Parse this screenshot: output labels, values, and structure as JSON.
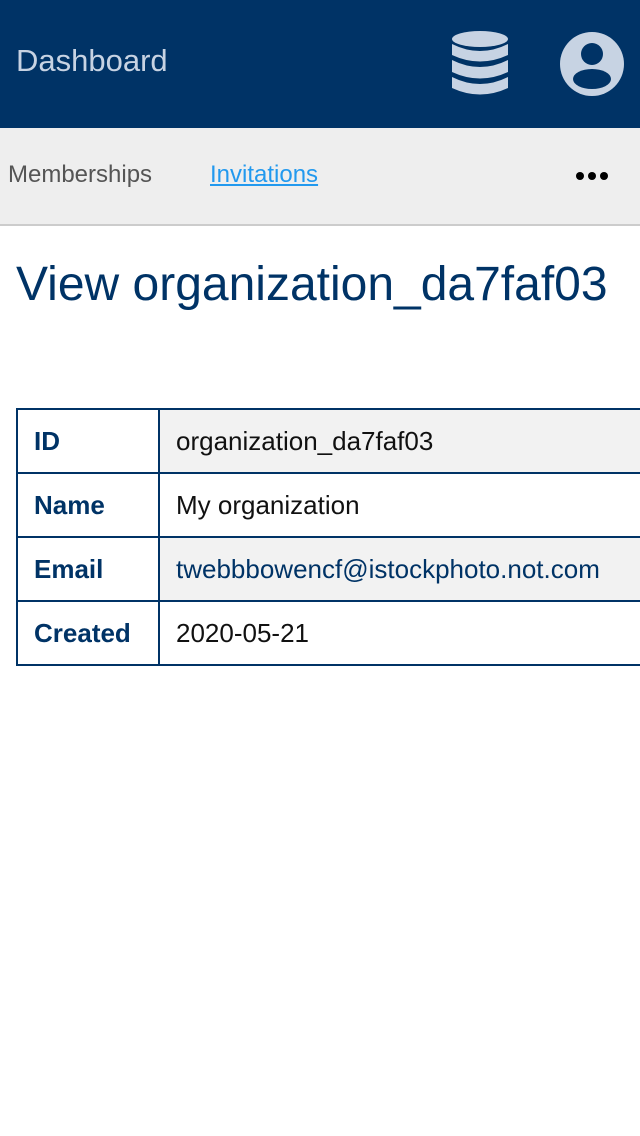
{
  "header": {
    "brand": "Dashboard",
    "icons": {
      "database": "database-icon",
      "account": "user-circle-icon"
    },
    "colors": {
      "background": "#003366",
      "icon": "#c7d3e3"
    }
  },
  "subnav": {
    "items": [
      {
        "label": "Memberships",
        "active": false
      },
      {
        "label": "Invitations",
        "active": true
      }
    ],
    "more_icon": "ellipsis-icon",
    "colors": {
      "background": "#eeeeee",
      "link": "#2299ee"
    }
  },
  "page": {
    "title": "View organization_da7faf03",
    "accent": "#003366"
  },
  "details": [
    {
      "label": "ID",
      "value": "organization_da7faf03"
    },
    {
      "label": "Name",
      "value": "My organization"
    },
    {
      "label": "Email",
      "value": "twebbbowencf@istockphoto.not.com"
    },
    {
      "label": "Created",
      "value": "2020-05-21"
    }
  ]
}
